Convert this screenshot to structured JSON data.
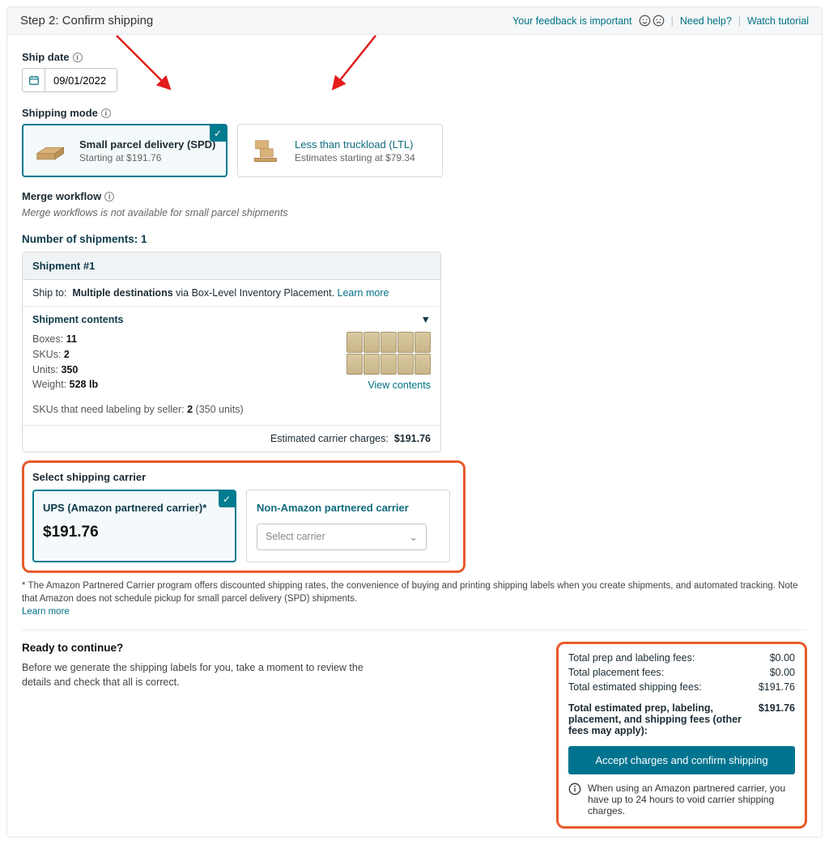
{
  "header": {
    "step_title": "Step 2: Confirm shipping",
    "feedback_text": "Your feedback is important",
    "need_help": "Need help?",
    "watch_tutorial": "Watch tutorial"
  },
  "ship_date": {
    "label": "Ship date",
    "value": "09/01/2022"
  },
  "shipping_mode": {
    "label": "Shipping mode",
    "options": [
      {
        "title": "Small parcel delivery (SPD)",
        "sub": "Starting at $191.76",
        "selected": true
      },
      {
        "title": "Less than truckload (LTL)",
        "sub": "Estimates starting at $79.34",
        "selected": false
      }
    ]
  },
  "merge": {
    "label": "Merge workflow",
    "note": "Merge workflows is not available for small parcel shipments"
  },
  "shipments": {
    "count_label": "Number of shipments: 1",
    "card_title": "Shipment #1",
    "ship_to_label": "Ship to:",
    "ship_to_bold": "Multiple destinations",
    "ship_to_rest": " via Box-Level Inventory Placement. ",
    "learn_more": "Learn more",
    "contents_title": "Shipment contents",
    "boxes_label": "Boxes:",
    "boxes": "11",
    "skus_label": "SKUs:",
    "skus": "2",
    "units_label": "Units:",
    "units": "350",
    "weight_label": "Weight:",
    "weight": "528 lb",
    "view_contents": "View contents",
    "labeling_label": "SKUs that need labeling by seller:",
    "labeling_value": "2",
    "labeling_units": "(350 units)",
    "est_label": "Estimated carrier charges:",
    "est_value": "$191.76"
  },
  "carrier": {
    "title": "Select shipping carrier",
    "partnered_title": "UPS (Amazon partnered carrier)*",
    "partnered_price": "$191.76",
    "non_partnered_title": "Non-Amazon partnered carrier",
    "select_placeholder": "Select carrier"
  },
  "footnote": {
    "text": "* The Amazon Partnered Carrier program offers discounted shipping rates, the convenience of buying and printing shipping labels when you create shipments, and automated tracking. Note that Amazon does not schedule pickup for small parcel delivery (SPD) shipments.",
    "learn_more": "Learn more"
  },
  "ready": {
    "title": "Ready to continue?",
    "text": "Before we generate the shipping labels for you, take a moment to review the details and check that all is correct."
  },
  "totals": {
    "rows": [
      {
        "label": "Total prep and labeling fees:",
        "value": "$0.00"
      },
      {
        "label": "Total placement fees:",
        "value": "$0.00"
      },
      {
        "label": "Total estimated shipping fees:",
        "value": "$191.76"
      }
    ],
    "bold_label": "Total estimated prep, labeling, placement, and shipping fees (other fees may apply):",
    "bold_value": "$191.76",
    "button": "Accept charges and confirm shipping",
    "note": "When using an Amazon partnered carrier, you have up to 24 hours to void carrier shipping charges."
  }
}
